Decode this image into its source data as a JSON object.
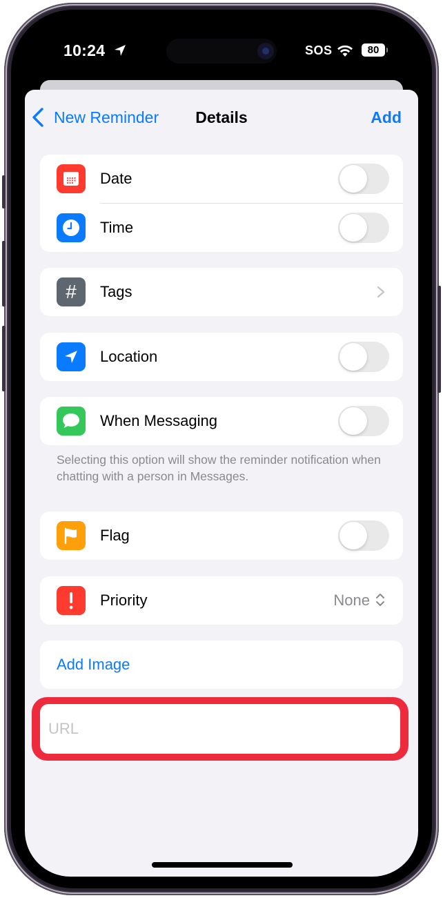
{
  "status_bar": {
    "time": "10:24",
    "location_icon": "location-arrow-icon",
    "carrier": "SOS",
    "wifi_icon": "wifi-icon",
    "battery_percent": "80"
  },
  "nav": {
    "back_label": "New Reminder",
    "title": "Details",
    "add_label": "Add"
  },
  "rows": {
    "date": {
      "label": "Date",
      "icon": "calendar-icon",
      "color": "#ff3b30",
      "on": false
    },
    "time": {
      "label": "Time",
      "icon": "clock-icon",
      "color": "#0a7aff",
      "on": false
    },
    "tags": {
      "label": "Tags",
      "icon": "hashtag-icon",
      "color": "#5e6670"
    },
    "location": {
      "label": "Location",
      "icon": "location-icon",
      "color": "#0a7aff",
      "on": false
    },
    "messaging": {
      "label": "When Messaging",
      "icon": "message-bubble-icon",
      "color": "#34c759",
      "on": false
    },
    "flag": {
      "label": "Flag",
      "icon": "flag-icon",
      "color": "#ff9f0a",
      "on": false
    },
    "priority": {
      "label": "Priority",
      "icon": "exclamation-icon",
      "color": "#ff3b30",
      "value": "None"
    }
  },
  "messaging_note": "Selecting this option will show the reminder notification when chatting with a person in Messages.",
  "add_image_label": "Add Image",
  "url_field": {
    "placeholder": "URL",
    "value": ""
  },
  "colors": {
    "accent": "#0a7aff",
    "highlight": "#ee2a3d",
    "background": "#f2f2f7"
  }
}
